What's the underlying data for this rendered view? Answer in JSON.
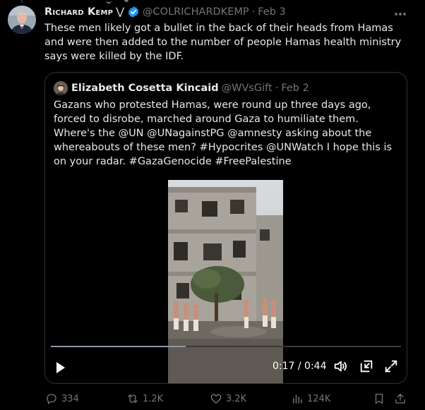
{
  "tweet": {
    "author_name": "Richard Kemp",
    "author_suffix": "⋁",
    "handle": "@COLRICHARDKEMP",
    "separator": "·",
    "date": "Feb 3",
    "text": "These men likely got a bullet in the back of their heads from Hamas and were then added to the number of people Hamas health ministry says were killed by the IDF.",
    "more_icon": "more-horizontal-icon"
  },
  "quote": {
    "author_name": "Elizabeth Cosetta Kincaid",
    "handle": "@WVsGift",
    "separator": "·",
    "date": "Feb 2",
    "text": "Gazans who protested Hamas, were round up three days ago, forced to disrobe, marched around Gaza to humiliate them. Where's the @UN @UNagainstPG @amnesty asking about the whereabouts of these men? #Hypocrites @UNWatch I hope this is on your radar. #GazaGenocide #FreePalestine"
  },
  "video": {
    "time_display": "0:17 / 0:44",
    "progress": 0.386,
    "controls": [
      "play-icon",
      "volume-icon",
      "minimize-icon",
      "fullscreen-icon"
    ]
  },
  "actions": {
    "replies": "334",
    "reposts": "1.2K",
    "likes": "3.2K",
    "views": "124K"
  },
  "colors": {
    "background": "#000000",
    "text": "#e7e9ea",
    "muted": "#71767b",
    "border": "#2f3336",
    "verified": "#1d9bf0"
  }
}
